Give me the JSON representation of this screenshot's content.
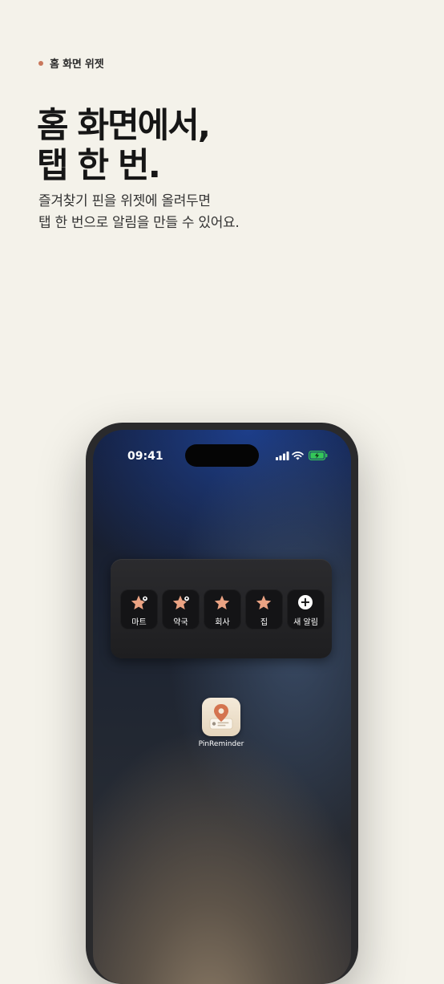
{
  "eyebrow": "홈 화면 위젯",
  "headline": [
    "홈 화면에서,",
    "탭 한 번."
  ],
  "subtitle": [
    "즐겨찾기 핀을 위젯에 올려두면",
    "탭 한 번으로 알림을 만들 수 있어요."
  ],
  "phone": {
    "time": "09:41",
    "widget": {
      "pins": [
        {
          "label": "마트",
          "icon": "star-pin-icon"
        },
        {
          "label": "약국",
          "icon": "star-pin-icon"
        },
        {
          "label": "회사",
          "icon": "star-icon"
        },
        {
          "label": "집",
          "icon": "star-icon"
        }
      ],
      "new_label": "새 알림"
    },
    "app_label": "PinReminder"
  },
  "colors": {
    "background": "#f4f2ea",
    "accent": "#c9785c",
    "star": "#eba383",
    "battery": "#34c759"
  }
}
